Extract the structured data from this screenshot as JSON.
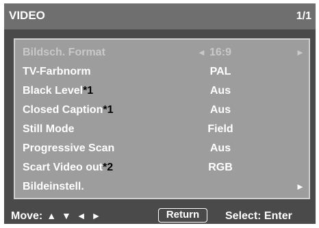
{
  "header": {
    "title": "VIDEO",
    "page": "1/1"
  },
  "menu": [
    {
      "label": "Bildsch. Format",
      "note": "",
      "value": "16:9",
      "left_arrow": "◄",
      "right_arrow": "►",
      "disabled": true
    },
    {
      "label": "TV-Farbnorm",
      "note": "",
      "value": "PAL"
    },
    {
      "label": "Black Level",
      "note": "*1",
      "value": "Aus"
    },
    {
      "label": "Closed Caption",
      "note": "*1",
      "value": "Aus"
    },
    {
      "label": "Still Mode",
      "note": "",
      "value": "Field"
    },
    {
      "label": "Progressive Scan",
      "note": "",
      "value": "Aus"
    },
    {
      "label": "Scart Video out",
      "note": "*2",
      "value": "RGB"
    },
    {
      "label": "Bildeinstell.",
      "note": "",
      "value": "",
      "right_arrow": "►"
    }
  ],
  "footer": {
    "move_label": "Move:",
    "move_keys": "▲ ▼ ◄ ►",
    "return_label": "Return",
    "select_label": "Select: Enter"
  },
  "colors": {
    "screen_bg": "#4a4a4a",
    "header_bg": "#6f6f6f",
    "panel_bg": "#9d9d9d",
    "text": "#ffffff",
    "disabled_text": "#c9c9c9",
    "note_text": "#000000"
  }
}
